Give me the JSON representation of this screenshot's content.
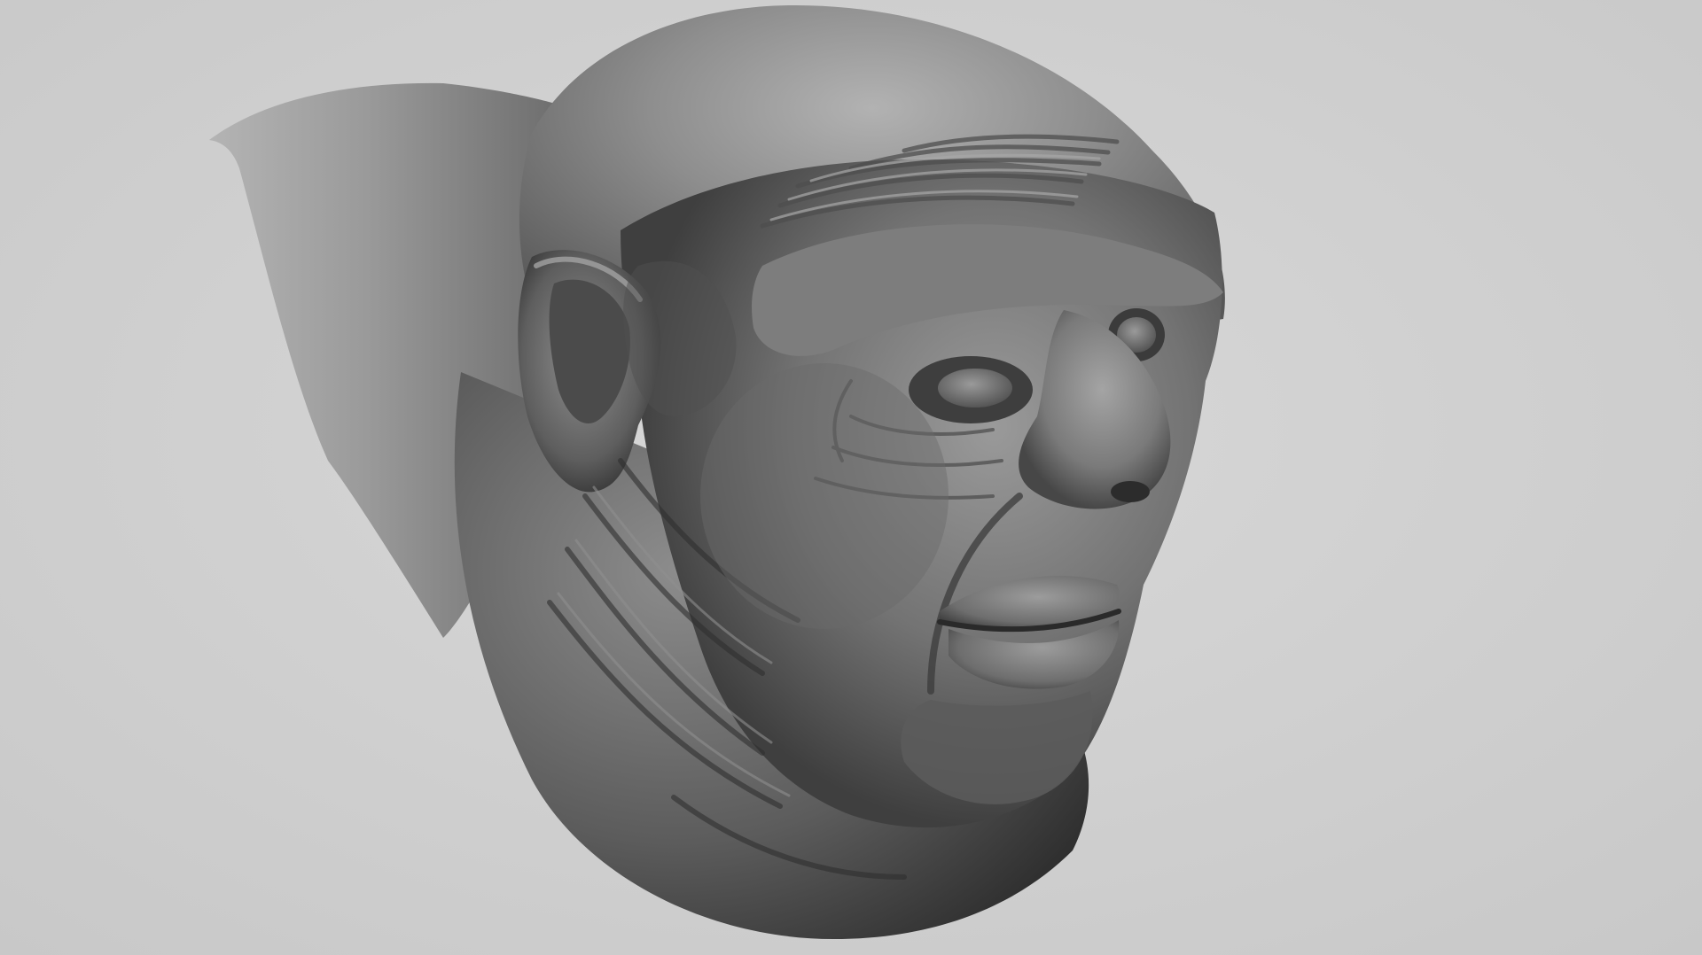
{
  "scene": {
    "subject": "sculpted-head-render",
    "palette": {
      "background": "#d4d4d4",
      "background_edge": "#c6c6c6",
      "skin_light": "#a7a7a7",
      "skin_mid": "#7a7a7a",
      "skin_dark": "#3e3e3e",
      "shadow": "#262626"
    }
  }
}
